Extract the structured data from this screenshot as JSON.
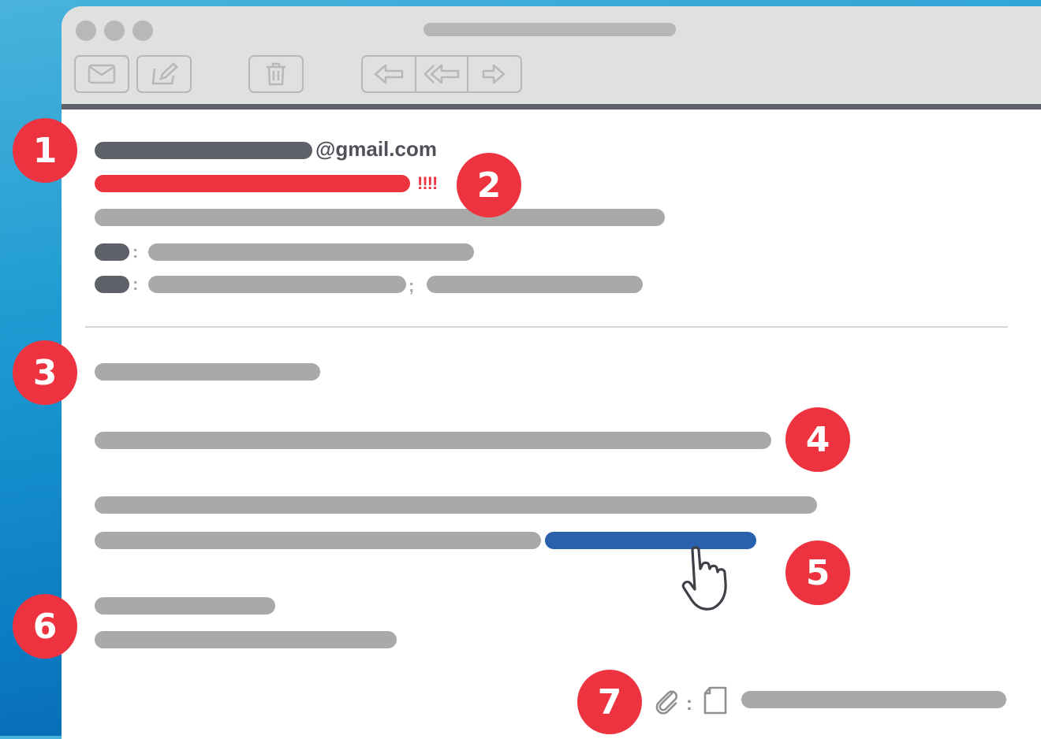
{
  "window": {
    "toolbar": {
      "icons": [
        "mail-icon",
        "compose-icon",
        "trash-icon",
        "reply-icon",
        "reply-all-icon",
        "forward-icon"
      ]
    }
  },
  "email": {
    "sender_domain": "@gmail.com",
    "urgency_marks": "!!!!",
    "to_separator": ":",
    "cc_separator": ":",
    "cc_list_separator": ";",
    "attachment_separator": ":"
  },
  "markers": [
    "1",
    "2",
    "3",
    "4",
    "5",
    "6",
    "7"
  ],
  "colors": {
    "accent_red": "#ee3340",
    "link_blue": "#2a61ae",
    "placeholder_gray": "#a7a9aa",
    "dark_gray": "#5e6168",
    "chrome_gray": "#dfe1df",
    "background_blue": "#1f9bd2"
  }
}
